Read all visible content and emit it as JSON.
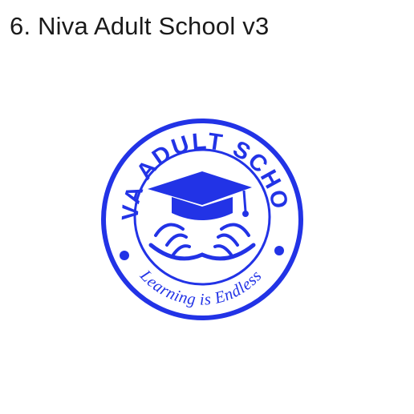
{
  "heading": "6. Niva Adult School v3",
  "logo": {
    "name_text": "NIVA ADULT SCHOOL",
    "tagline_text": "Learning is Endless",
    "icon": "graduation-cap-over-open-book",
    "color": "#2233e6"
  }
}
